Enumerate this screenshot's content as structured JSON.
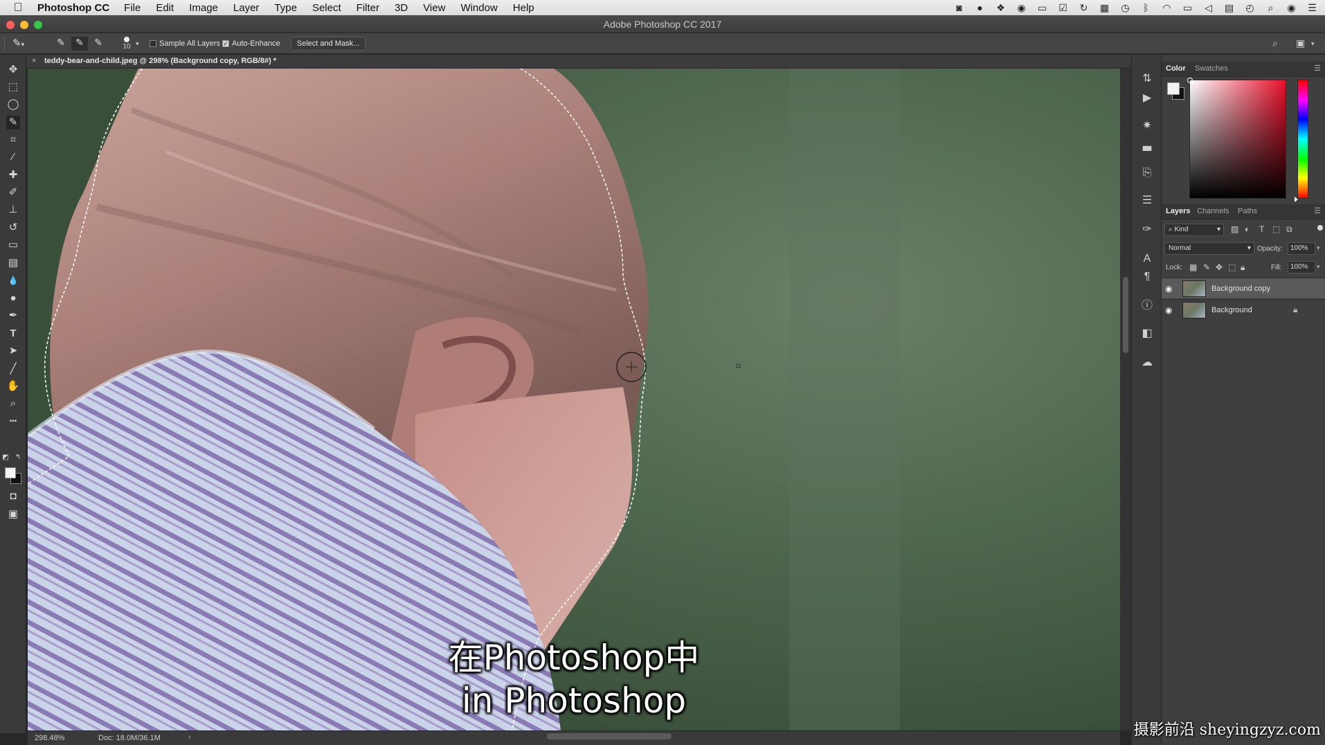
{
  "menubar": {
    "app_name": "Photoshop CC",
    "items": [
      "File",
      "Edit",
      "Image",
      "Layer",
      "Type",
      "Select",
      "Filter",
      "3D",
      "View",
      "Window",
      "Help"
    ]
  },
  "window": {
    "title": "Adobe Photoshop CC 2017"
  },
  "options_bar": {
    "brush_size": "10",
    "sample_all_layers_label": "Sample All Layers",
    "sample_all_layers_checked": false,
    "auto_enhance_label": "Auto-Enhance",
    "auto_enhance_checked": true,
    "select_mask_label": "Select and Mask..."
  },
  "document": {
    "tab_title": "teddy-bear-and-child.jpeg @ 298% (Background copy, RGB/8#) *",
    "close_glyph": "×"
  },
  "status_bar": {
    "zoom": "298.48%",
    "doc_size": "Doc: 18.0M/36.1M",
    "arrow": "›"
  },
  "color_panel": {
    "tabs": [
      "Color",
      "Swatches"
    ],
    "foreground_color": "#f2f2f2",
    "background_color": "#111111",
    "hue_color": "#e8102a"
  },
  "layers_panel": {
    "tabs": [
      "Layers",
      "Channels",
      "Paths"
    ],
    "filter_kind": "Kind",
    "blend_mode": "Normal",
    "opacity_label": "Opacity:",
    "opacity_value": "100%",
    "lock_label": "Lock:",
    "fill_label": "Fill:",
    "fill_value": "100%",
    "layers": [
      {
        "name": "Background copy",
        "visible": true,
        "selected": true,
        "locked": false
      },
      {
        "name": "Background",
        "visible": true,
        "selected": false,
        "locked": true
      }
    ]
  },
  "subtitles": {
    "line1": "在Photoshop中",
    "line2": "in Photoshop"
  },
  "watermark": "摄影前沿 sheyingzyz.com",
  "icons": {
    "apple": "",
    "move": "✥",
    "marquee": "⬚",
    "lasso": "◯",
    "quick_select": "✎",
    "crop": "⌗",
    "eyedropper": "⁄",
    "healing": "✚",
    "brush": "✐",
    "stamp": "⊥",
    "history_brush": "↺",
    "eraser": "▭",
    "gradient": "▤",
    "blur": "💧",
    "dodge": "●",
    "pen": "✒",
    "type": "T",
    "path_select": "➤",
    "line": "╱",
    "hand": "✋",
    "zoom": "⌕",
    "more": "•••",
    "mask_mode": "◘",
    "screen_mode": "▣"
  }
}
